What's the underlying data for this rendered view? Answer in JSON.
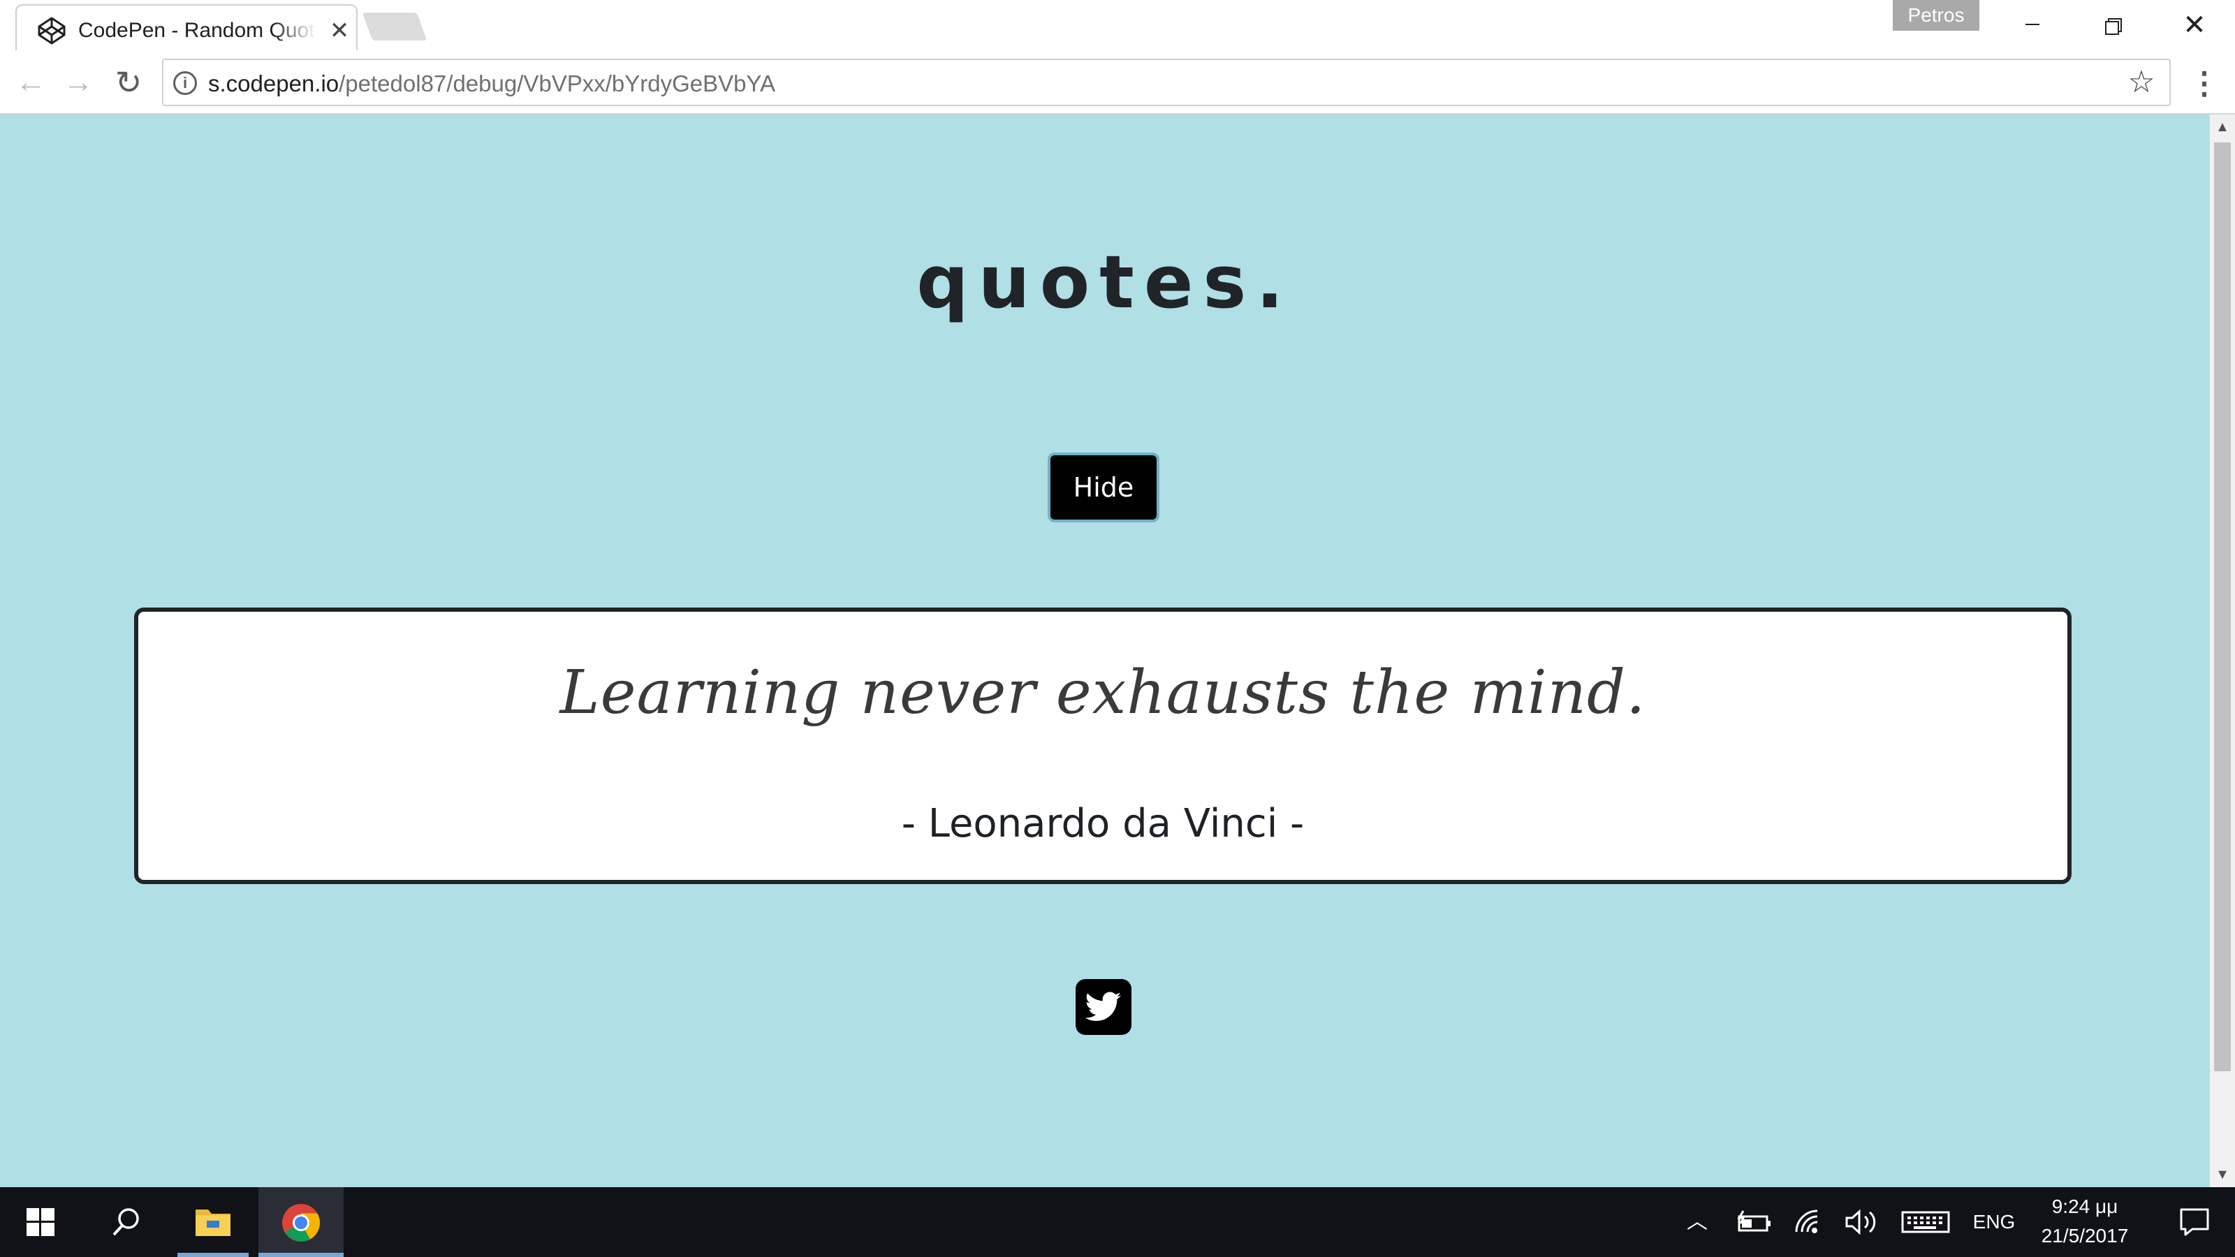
{
  "browser": {
    "tab": {
      "title": "CodePen - Random Quote Machine",
      "close": "✕"
    },
    "profile": "Petros",
    "window_close": "✕",
    "address": {
      "host": "s.codepen.io",
      "path": "/petedol87/debug/VbVPxx/bYrdyGeBVbYA"
    },
    "nav": {
      "back": "←",
      "forward": "→",
      "reload": "↻",
      "bookmark": "☆",
      "menu": "⋮"
    }
  },
  "page": {
    "title": "quotes.",
    "hide_button": "Hide",
    "quote": {
      "text": "Learning never exhausts the mind.",
      "author": "- Leonardo da Vinci -"
    },
    "tweet_icon": "twitter-icon",
    "background": "#b0dfe5"
  },
  "scrollbar": {
    "up": "▲",
    "down": "▼"
  },
  "taskbar": {
    "tray": {
      "chevron": "︿",
      "lang": "ENG",
      "time": "9:24 μμ",
      "date": "21/5/2017"
    },
    "icons": [
      "windows-start-icon",
      "search-icon",
      "file-explorer-icon",
      "chrome-icon",
      "battery-icon",
      "network-icon",
      "volume-icon",
      "keyboard-icon",
      "action-center-icon"
    ]
  }
}
